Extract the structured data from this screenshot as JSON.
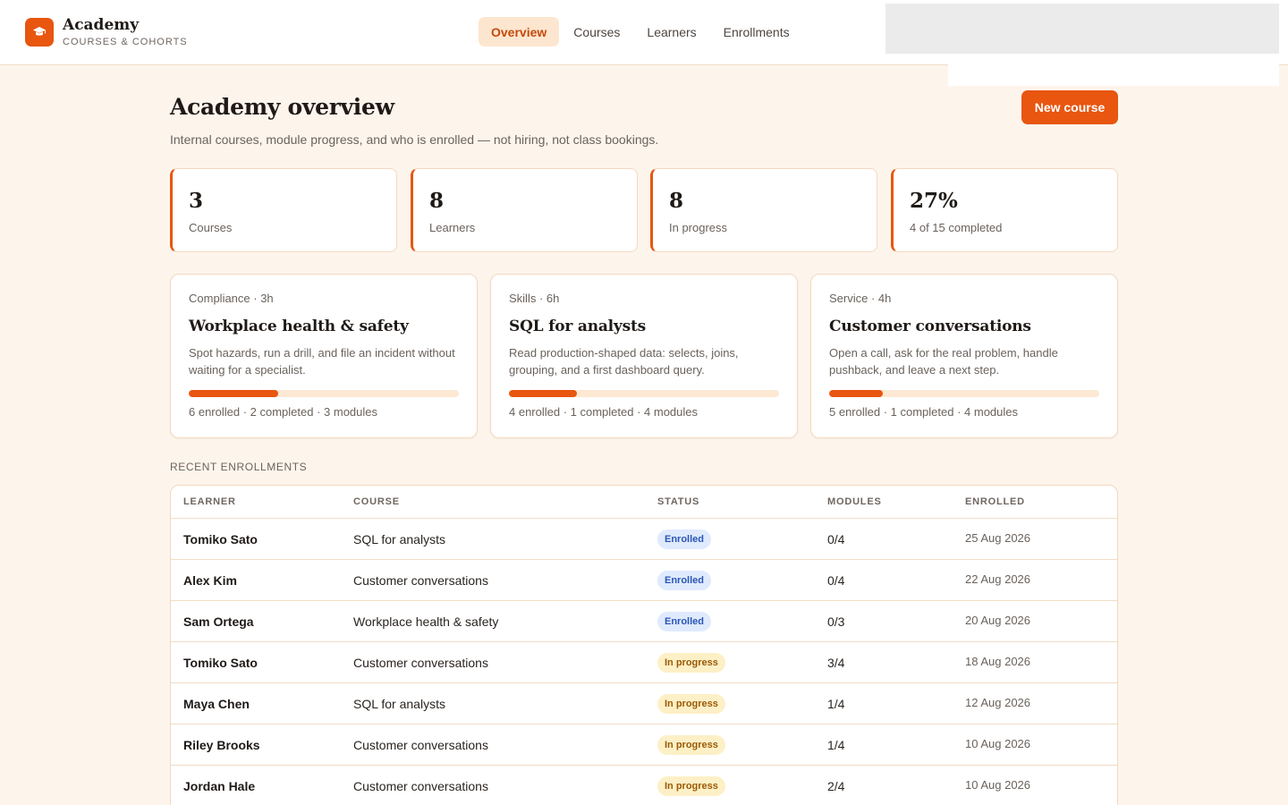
{
  "app": {
    "name": "Academy",
    "subtitle": "COURSES & COHORTS",
    "logo_icon": "graduation-cap-icon",
    "accent": "#e8560f"
  },
  "nav": {
    "items": [
      {
        "label": "Overview",
        "active": true
      },
      {
        "label": "Courses",
        "active": false
      },
      {
        "label": "Learners",
        "active": false
      },
      {
        "label": "Enrollments",
        "active": false
      }
    ]
  },
  "page": {
    "title": "Academy overview",
    "subtitle": "Internal courses, module progress, and who is enrolled — not hiring, not class bookings.",
    "new_course_label": "New course"
  },
  "stats": [
    {
      "value": "3",
      "label": "Courses"
    },
    {
      "value": "8",
      "label": "Learners"
    },
    {
      "value": "8",
      "label": "In progress"
    },
    {
      "value": "27%",
      "label": "4 of 15 completed"
    }
  ],
  "courses": [
    {
      "meta": "Compliance · 3h",
      "title": "Workplace health & safety",
      "description": "Spot hazards, run a drill, and file an incident without waiting for a specialist.",
      "progress": 0.33,
      "stats": "6 enrolled · 2 completed · 3 modules"
    },
    {
      "meta": "Skills · 6h",
      "title": "SQL for analysts",
      "description": "Read production-shaped data: selects, joins, grouping, and a first dashboard query.",
      "progress": 0.25,
      "stats": "4 enrolled · 1 completed · 4 modules"
    },
    {
      "meta": "Service · 4h",
      "title": "Customer conversations",
      "description": "Open a call, ask for the real problem, handle pushback, and leave a next step.",
      "progress": 0.2,
      "stats": "5 enrolled · 1 completed · 4 modules"
    }
  ],
  "enrollments": {
    "section_label": "RECENT ENROLLMENTS",
    "columns": [
      "LEARNER",
      "COURSE",
      "STATUS",
      "MODULES",
      "ENROLLED"
    ],
    "rows": [
      {
        "learner": "Tomiko Sato",
        "course": "SQL for analysts",
        "status": "Enrolled",
        "status_kind": "enrolled",
        "modules": "0/4",
        "enrolled": "25 Aug 2026"
      },
      {
        "learner": "Alex Kim",
        "course": "Customer conversations",
        "status": "Enrolled",
        "status_kind": "enrolled",
        "modules": "0/4",
        "enrolled": "22 Aug 2026"
      },
      {
        "learner": "Sam Ortega",
        "course": "Workplace health & safety",
        "status": "Enrolled",
        "status_kind": "enrolled",
        "modules": "0/3",
        "enrolled": "20 Aug 2026"
      },
      {
        "learner": "Tomiko Sato",
        "course": "Customer conversations",
        "status": "In progress",
        "status_kind": "inprogress",
        "modules": "3/4",
        "enrolled": "18 Aug 2026"
      },
      {
        "learner": "Maya Chen",
        "course": "SQL for analysts",
        "status": "In progress",
        "status_kind": "inprogress",
        "modules": "1/4",
        "enrolled": "12 Aug 2026"
      },
      {
        "learner": "Riley Brooks",
        "course": "Customer conversations",
        "status": "In progress",
        "status_kind": "inprogress",
        "modules": "1/4",
        "enrolled": "10 Aug 2026"
      },
      {
        "learner": "Jordan Hale",
        "course": "Customer conversations",
        "status": "In progress",
        "status_kind": "inprogress",
        "modules": "2/4",
        "enrolled": "10 Aug 2026"
      }
    ]
  }
}
